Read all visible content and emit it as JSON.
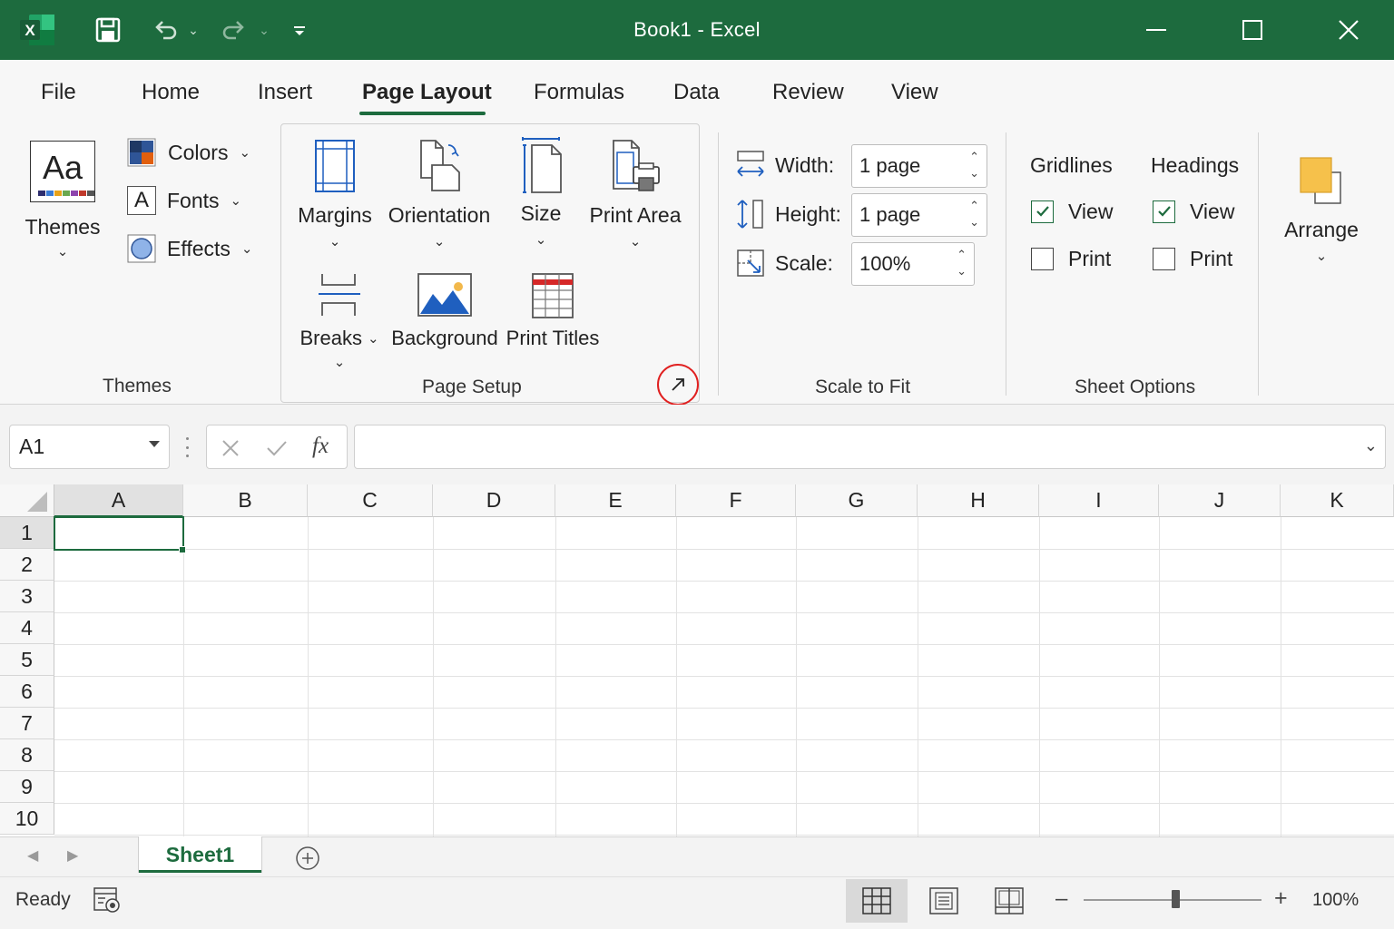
{
  "titlebar": {
    "title": "Book1  -  Excel",
    "bg": "#1d6b3e",
    "icons": [
      "excel-logo-icon",
      "save-icon",
      "undo-icon",
      "redo-icon",
      "customize-qat-icon",
      "minimize-icon",
      "maximize-icon",
      "close-icon"
    ]
  },
  "tabs": [
    {
      "label": "File"
    },
    {
      "label": "Home"
    },
    {
      "label": "Insert"
    },
    {
      "label": "Page Layout",
      "active": true
    },
    {
      "label": "Formulas"
    },
    {
      "label": "Data"
    },
    {
      "label": "Review"
    },
    {
      "label": "View"
    }
  ],
  "themes_group": {
    "themes_icon_text": "Aa",
    "themes_label": "Themes",
    "colors_label": "Colors",
    "fonts_icon_text": "A",
    "fonts_label": "Fonts",
    "effects_label": "Effects",
    "group_label": "Themes"
  },
  "page_setup": {
    "margins": "Margins",
    "orientation": "Orientation",
    "size": "Size",
    "print_area": "Print Area",
    "breaks": "Breaks",
    "background": "Background",
    "print_titles": "Print Titles",
    "group_label": "Page Setup",
    "launcher_highlight_color": "#e02020"
  },
  "scale_to_fit": {
    "width_label": "Width:",
    "width_value": "1 page",
    "height_label": "Height:",
    "height_value": "1 page",
    "scale_label": "Scale:",
    "scale_value": "100%",
    "group_label": "Scale to Fit"
  },
  "sheet_options": {
    "gridlines": "Gridlines",
    "headings": "Headings",
    "gridlines_view": "View",
    "gridlines_print": "Print",
    "headings_view": "View",
    "headings_print": "Print",
    "gridlines_view_checked": true,
    "gridlines_print_checked": false,
    "headings_view_checked": true,
    "headings_print_checked": false,
    "group_label": "Sheet Options"
  },
  "arrange": {
    "label": "Arrange"
  },
  "formula_bar": {
    "name_box": "A1",
    "fx": "fx",
    "formula": ""
  },
  "grid": {
    "columns": [
      "A",
      "B",
      "C",
      "D",
      "E",
      "F",
      "G",
      "H",
      "I",
      "J",
      "K"
    ],
    "rows": [
      "1",
      "2",
      "3",
      "4",
      "5",
      "6",
      "7",
      "8",
      "9",
      "10"
    ],
    "selected_cell": "A1",
    "accent": "#1d6b3e"
  },
  "sheets": {
    "active": "Sheet1"
  },
  "status": {
    "ready": "Ready",
    "zoom_minus": "–",
    "zoom_plus": "+",
    "zoom": "100%"
  }
}
